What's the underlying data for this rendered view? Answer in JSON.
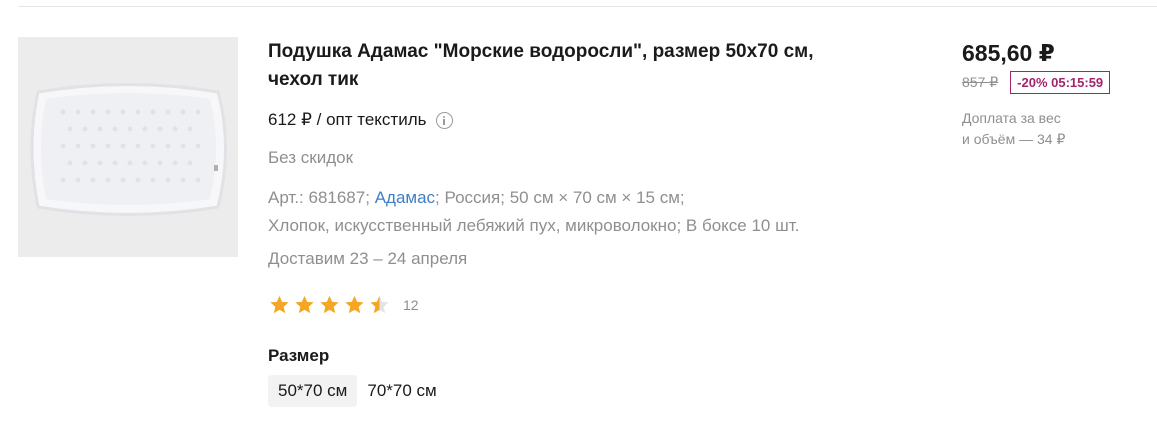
{
  "product": {
    "title_line1": "Подушка Адамас \"Морские водоросли\", размер 50х70 см,",
    "title_line2": "чехол тик",
    "opt_price": "612 ₽ / опт текстиль",
    "no_discount": "Без скидок",
    "attrs": {
      "article_prefix": "Арт.: 681687;",
      "brand": "Адамас",
      "rest_line1": "; Россия; 50 см × 70 см × 15 см;",
      "line2": "Хлопок, искусственный лебяжий пух, микроволокно; В боксе 10 шт."
    },
    "delivery": "Доставим 23 – 24 апреля",
    "rating": {
      "value": 4.5,
      "max": 5,
      "review_count": "12",
      "star_color": "#f5a623"
    },
    "size": {
      "label": "Размер",
      "options": [
        "50*70 см",
        "70*70 см"
      ],
      "selected": "50*70 см"
    }
  },
  "pricing": {
    "price": "685,60 ₽",
    "old_price": "857 ₽",
    "discount_badge": "-20% 05:15:59",
    "surcharge_line1": "Доплата за вес",
    "surcharge_line2": "и объём — 34 ₽",
    "badge_color": "#a4236d"
  },
  "colors": {
    "link": "#3f7fc6",
    "muted": "#8f8f8f"
  },
  "icons": {
    "info": "info-icon",
    "star": "star-icon"
  }
}
